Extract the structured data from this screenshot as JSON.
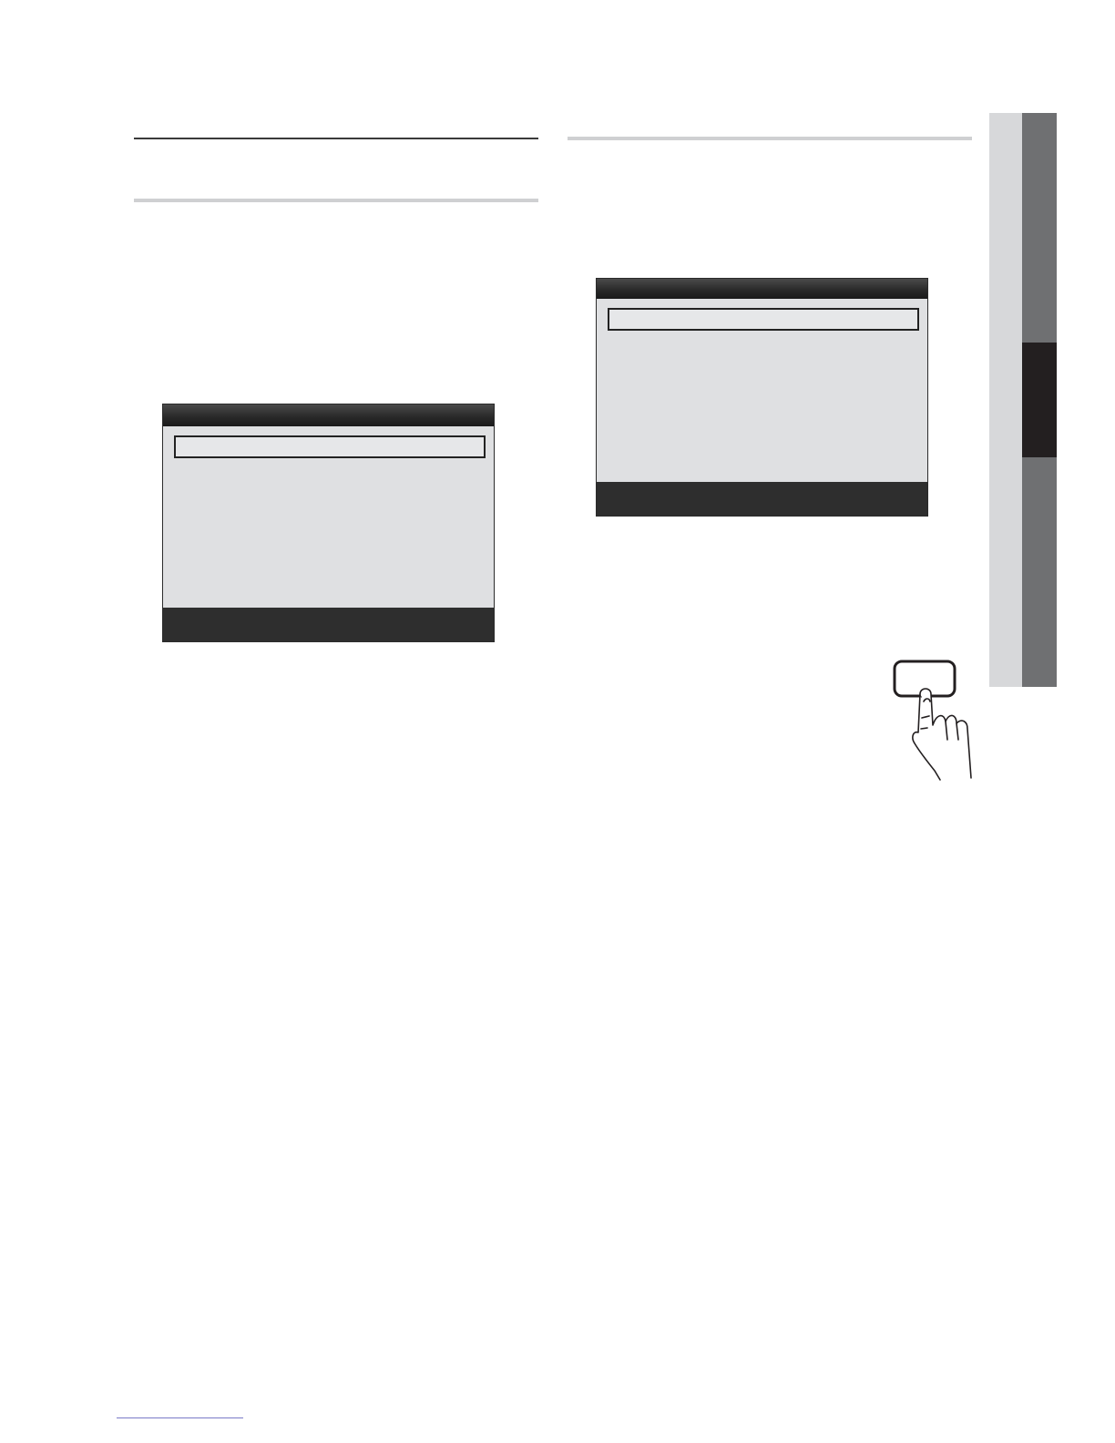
{
  "page": {
    "background": "#ffffff"
  },
  "left_section": {
    "osd_menu": {
      "header_color": "#2a2a2a",
      "body_color": "#dfe0e2",
      "footer_color": "#2e2e2e"
    }
  },
  "right_section": {
    "osd_menu": {
      "header_color": "#2a2a2a",
      "body_color": "#dfe0e2",
      "footer_color": "#2e2e2e"
    }
  },
  "chapter_tabs": {
    "light_color": "#d7d8da",
    "dark_color": "#6f7072",
    "active_color": "#231f20"
  },
  "remote_illustration": {
    "icon": "finger-pressing-remote-button-icon"
  }
}
